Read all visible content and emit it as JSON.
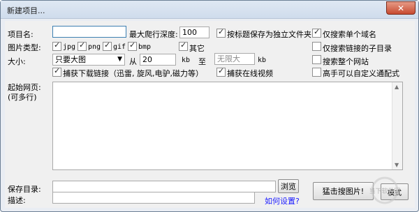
{
  "window": {
    "title": "新建项目...",
    "close_label": "✕"
  },
  "project_name": {
    "label": "项目名:",
    "value": ""
  },
  "max_depth": {
    "label": "最大爬行深度:",
    "value": "100"
  },
  "save_by_title": {
    "label": "按标题保存为独立文件夹",
    "checked": true
  },
  "single_domain": {
    "label": "仅搜索单个域名",
    "checked": true
  },
  "image_type": {
    "label": "图片类型:",
    "options": [
      {
        "label": "jpg",
        "checked": true
      },
      {
        "label": "png",
        "checked": true
      },
      {
        "label": "gif",
        "checked": true
      },
      {
        "label": "bmp",
        "checked": true
      },
      {
        "label": "其它",
        "checked": true
      }
    ]
  },
  "child_dir_only": {
    "label": "仅搜索链接的子目录",
    "checked": false
  },
  "size": {
    "label": "大小:",
    "select_value": "只要大图",
    "from_label": "从",
    "from_value": "20",
    "unit1": "kb",
    "to_label": "至",
    "to_value": "无限大",
    "unit2": "kb"
  },
  "search_site": {
    "label": "搜索整个网站",
    "checked": false
  },
  "capture_download": {
    "label": "捕获下载链接（迅雷, 旋风,电驴,磁力等）",
    "checked": true
  },
  "capture_video": {
    "label": "捕获在线视频",
    "checked": true
  },
  "custom_wildcard": {
    "label": "高手可以自定义通配式",
    "checked": false
  },
  "start_url": {
    "label1": "起始网页:",
    "label2": "(可多行)"
  },
  "save_dir": {
    "label": "保存目录:",
    "value": "",
    "browse_label": "浏览"
  },
  "description": {
    "label": "描述:",
    "value": ""
  },
  "help_link": "如何设置?",
  "grab_button": "猛击搜图片!",
  "mode_button": "模式",
  "watermark": {
    "text": "当下软件园"
  }
}
